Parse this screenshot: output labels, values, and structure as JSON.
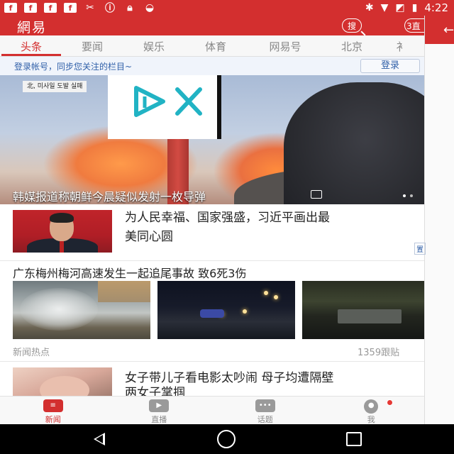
{
  "status_bar": {
    "left_icons": [
      "facebook-icon",
      "facebook-icon",
      "facebook-icon",
      "facebook-icon",
      "tools-icon",
      "alert-icon",
      "lock-icon",
      "android-icon"
    ],
    "time": "4:22",
    "right_icons": [
      "bluetooth-icon",
      "wifi-icon",
      "no-signal-icon",
      "battery-icon"
    ]
  },
  "header": {
    "logo": "網易",
    "search_label": "搜",
    "headlines_label": "3直"
  },
  "tabs": [
    {
      "label": "头条",
      "active": true
    },
    {
      "label": "要闻",
      "active": false
    },
    {
      "label": "娱乐",
      "active": false
    },
    {
      "label": "体育",
      "active": false
    },
    {
      "label": "网易号",
      "active": false
    },
    {
      "label": "北京",
      "active": false
    },
    {
      "label": "衤",
      "active": false
    }
  ],
  "login_bar": {
    "text": "登录帐号，同步您关注的栏目~",
    "button": "登录"
  },
  "hero": {
    "caption_tag": "北, 미사일 도발 실패",
    "title": "韩媒报道称朝鲜今晨疑似发射一枚导弹"
  },
  "news": [
    {
      "headline_line1": "为人民幸福、国家强盛，习近平画出最",
      "headline_line2": "美同心圆",
      "tag": "置"
    },
    {
      "headline": "广东梅州梅河高速发生一起追尾事故 致6死3伤",
      "source": "新闻热点",
      "comments": "1359跟贴"
    },
    {
      "headline_line1": "女子带儿子看电影太吵闹 母子均遭隔壁",
      "headline_line2": "两女子掌掴"
    }
  ],
  "bottom_nav": [
    {
      "label": "新闻",
      "icon": "news-icon",
      "active": true
    },
    {
      "label": "直播",
      "icon": "play-icon",
      "active": false
    },
    {
      "label": "话题",
      "icon": "chat-icon",
      "active": false
    },
    {
      "label": "我",
      "icon": "profile-icon",
      "active": false
    }
  ],
  "colors": {
    "brand": "#d32f2f",
    "link": "#2f5fa8"
  }
}
